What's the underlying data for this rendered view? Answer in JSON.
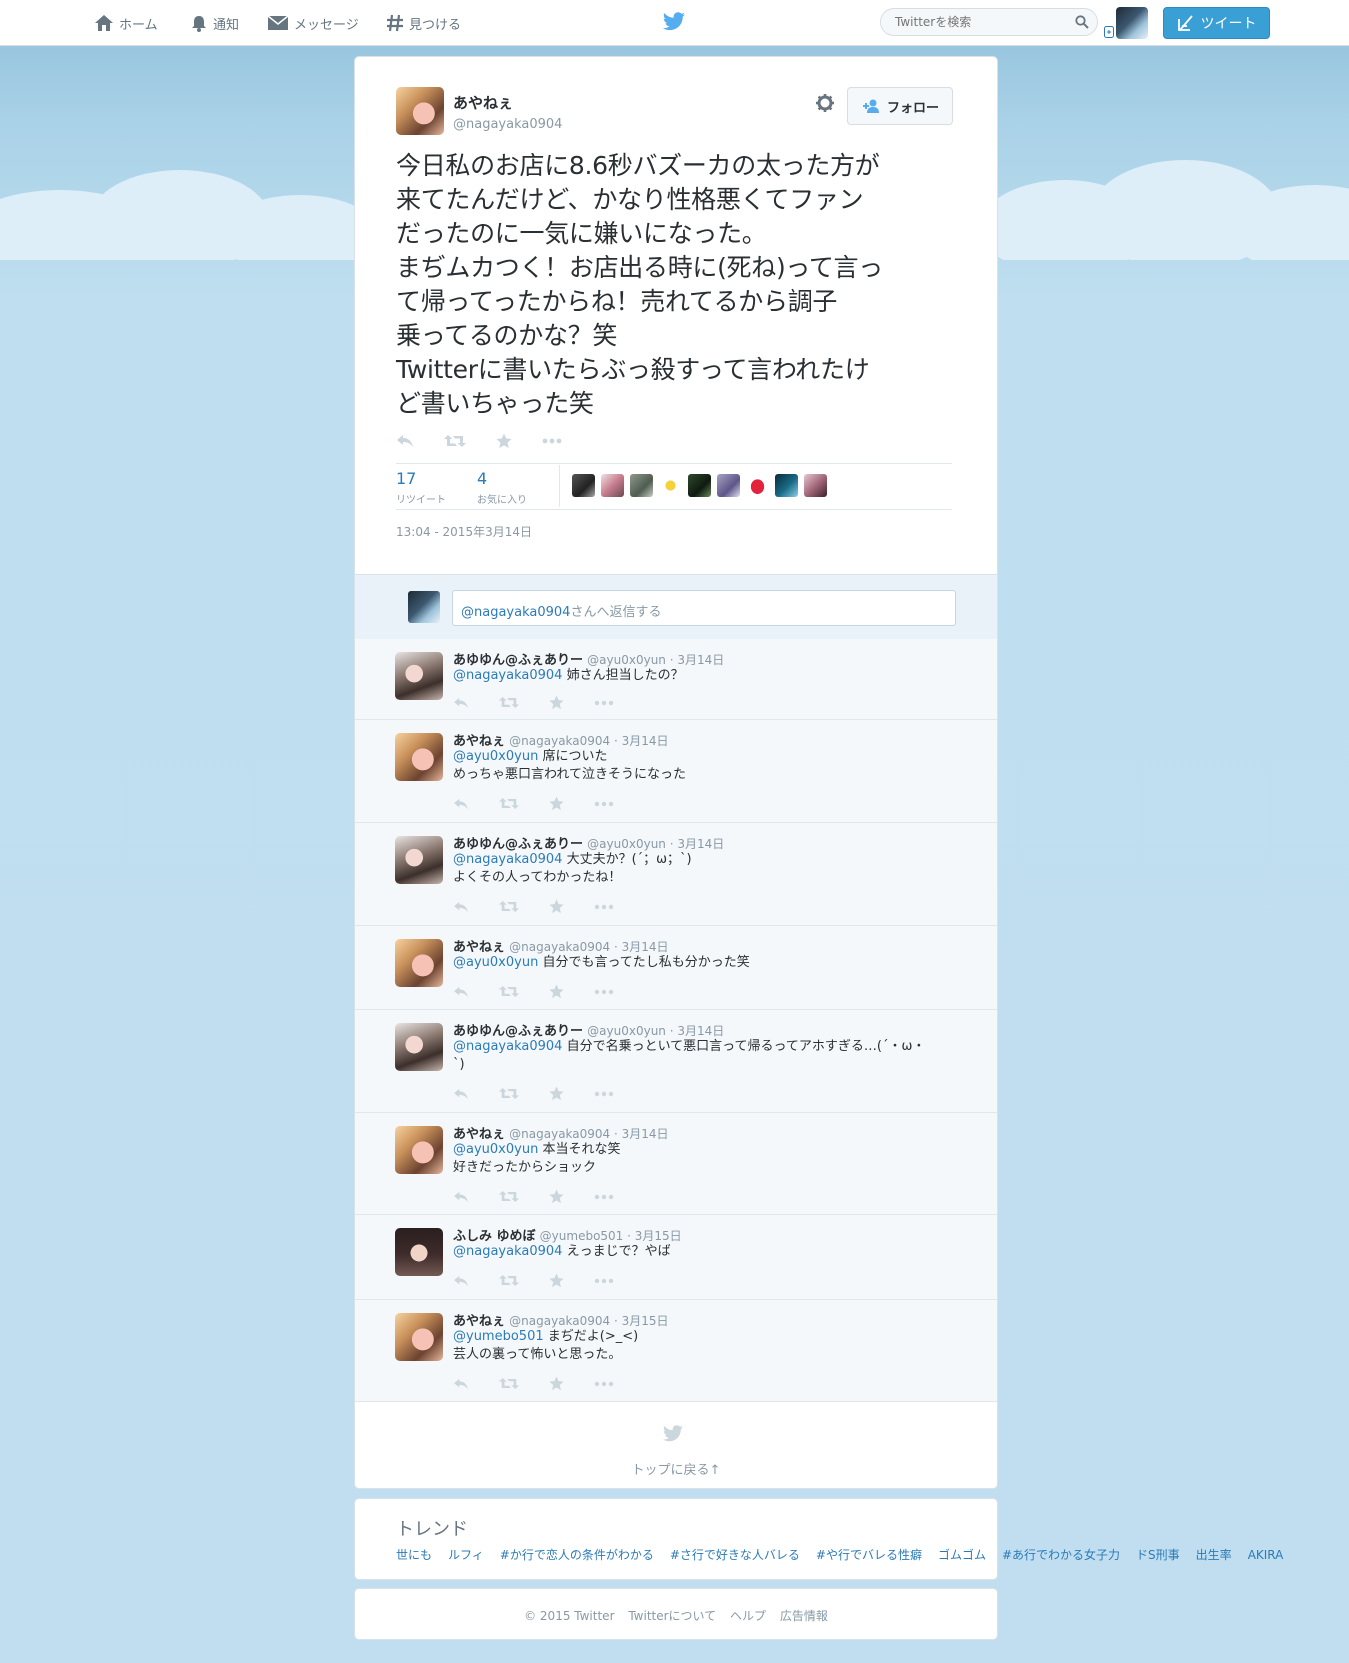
{
  "nav": {
    "home": "ホーム",
    "notifications": "通知",
    "messages": "メッセージ",
    "discover": "見つける",
    "search_placeholder": "Twitterを検索",
    "tweet_button": "ツイート"
  },
  "tweet": {
    "author_name": "あやねぇ",
    "author_handle": "@nagayaka0904",
    "follow_label": "フォロー",
    "text": "今日私のお店に8.6秒バズーカの太った方が\n来てたんだけど、かなり性格悪くてファン\nだったのに一気に嫌いになった。\nまぢムカつく！お店出る時に(死ね)って言っ\nて帰ってったからね！売れてるから調子\n乗ってるのかな？笑\nTwitterに書いたらぶっ殺すって言われたけ\nど書いちゃった笑",
    "retweet_count": "17",
    "retweet_label": "リツイート",
    "favorite_count": "4",
    "favorite_label": "お気に入り",
    "timestamp": "13:04 - 2015年3月14日"
  },
  "reply_box": {
    "mention": "@nagayaka0904",
    "suffix": "さんへ返信する"
  },
  "replies": [
    {
      "name": "あゆゆん@ふぇありー",
      "meta": "@ayu0x0yun · 3月14日",
      "mention": "@nagayaka0904",
      "text": " 姉さん担当したの？"
    },
    {
      "name": "あやねぇ",
      "meta": "@nagayaka0904 · 3月14日",
      "mention": "@ayu0x0yun",
      "text": " 席についた\nめっちゃ悪口言われて泣きそうになった"
    },
    {
      "name": "あゆゆん@ふぇありー",
      "meta": "@ayu0x0yun · 3月14日",
      "mention": "@nagayaka0904",
      "text": " 大丈夫か？(´；ω；`)\nよくその人ってわかったね！"
    },
    {
      "name": "あやねぇ",
      "meta": "@nagayaka0904 · 3月14日",
      "mention": "@ayu0x0yun",
      "text": " 自分でも言ってたし私も分かった笑"
    },
    {
      "name": "あゆゆん@ふぇありー",
      "meta": "@ayu0x0yun · 3月14日",
      "mention": "@nagayaka0904",
      "text": " 自分で名乗っといて悪口言って帰るってアホすぎる…(´・ω・\n`)"
    },
    {
      "name": "あやねぇ",
      "meta": "@nagayaka0904 · 3月14日",
      "mention": "@ayu0x0yun",
      "text": " 本当それな笑\n好きだったからショック"
    },
    {
      "name": "ふしみ ゆめぼ",
      "meta": "@yumebo501 · 3月15日",
      "mention": "@nagayaka0904",
      "text": " えっまじで？やば"
    },
    {
      "name": "あやねぇ",
      "meta": "@nagayaka0904 · 3月15日",
      "mention": "@yumebo501",
      "text": " まぢだよ(>_<)\n芸人の裏って怖いと思った。"
    }
  ],
  "back_to_top": "トップに戻る↑",
  "trends": {
    "title": "トレンド",
    "items": [
      "世にも",
      "ルフィ",
      "#か行で恋人の条件がわかる",
      "#さ行で好きな人バレる",
      "#や行でバレる性癖",
      "ゴムゴム",
      "#あ行でわかる女子力",
      "ドS刑事",
      "出生率",
      "AKIRA"
    ]
  },
  "footer": {
    "copyright": "© 2015 Twitter",
    "about": "Twitterについて",
    "help": "ヘルプ",
    "ads": "広告情報"
  },
  "colors": {
    "link": "#2b7bb9",
    "tweet_button": "#3a9fd5",
    "background": "#c0def0"
  }
}
